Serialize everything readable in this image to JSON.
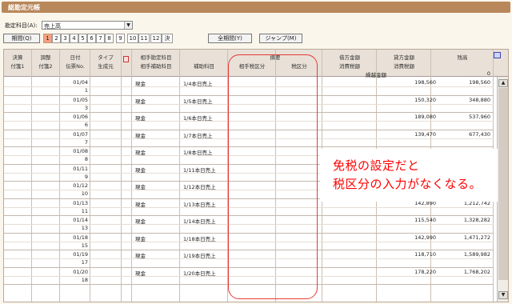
{
  "window": {
    "title": "総勘定元帳"
  },
  "account": {
    "label": "勘定科目(A):",
    "value": "売上高"
  },
  "period": {
    "label": "期間(Q)",
    "months": [
      "1",
      "2",
      "3",
      "4",
      "5",
      "6",
      "7",
      "8",
      "9",
      "10",
      "11",
      "12",
      "決"
    ],
    "selected": "1",
    "all_period_label": "全期間(Y)",
    "jump_label": "ジャンプ(M)"
  },
  "columns": {
    "kessan": "決算",
    "fusen1": "付箋1",
    "chosei": "調整",
    "fusen2": "付箋2",
    "hizuke": "日付",
    "denpyo": "伝票No.",
    "type": "タイプ",
    "seiseimoto": "生成元",
    "aite_kamoku": "相手勘定科目",
    "aite_hojo": "相手補助科目",
    "hojo": "補助科目",
    "tekiyo": "摘要",
    "aite_zeiku": "相手税区分",
    "zeiku": "税区分",
    "karikata": "借方金額",
    "shohizei1": "消費税額",
    "kashikata": "貸方金額",
    "shohizei2": "消費税額",
    "zandaka": "残高",
    "kurikoshi": "繰越金額",
    "kurikoshi_value": "0"
  },
  "rows": [
    {
      "date": "01/04",
      "no": "1",
      "account": "現金",
      "memo": "1/4本日売上",
      "credit": "198,560",
      "balance": "198,560"
    },
    {
      "date": "01/05",
      "no": "3",
      "account": "現金",
      "memo": "1/5本日売上",
      "credit": "150,320",
      "balance": "348,880"
    },
    {
      "date": "01/06",
      "no": "6",
      "account": "現金",
      "memo": "1/6本日売上",
      "credit": "189,080",
      "balance": "537,960"
    },
    {
      "date": "01/07",
      "no": "7",
      "account": "現金",
      "memo": "1/7本日売上",
      "credit": "139,470",
      "balance": "677,430"
    },
    {
      "date": "01/08",
      "no": "8",
      "account": "現金",
      "memo": "1/8本日売上",
      "credit": "",
      "balance": ""
    },
    {
      "date": "01/11",
      "no": "9",
      "account": "現金",
      "memo": "1/11本日売上",
      "credit": "",
      "balance": ""
    },
    {
      "date": "01/12",
      "no": "10",
      "account": "現金",
      "memo": "1/12本日売上",
      "credit": "",
      "balance": ""
    },
    {
      "date": "01/13",
      "no": "11",
      "account": "現金",
      "memo": "1/13本日売上",
      "credit": "142,890",
      "balance": "1,212,742"
    },
    {
      "date": "01/14",
      "no": "13",
      "account": "現金",
      "memo": "1/14本日売上",
      "credit": "115,540",
      "balance": "1,328,282"
    },
    {
      "date": "01/18",
      "no": "15",
      "account": "現金",
      "memo": "1/18本日売上",
      "credit": "142,990",
      "balance": "1,471,272"
    },
    {
      "date": "01/19",
      "no": "17",
      "account": "現金",
      "memo": "1/19本日売上",
      "credit": "118,710",
      "balance": "1,589,982"
    },
    {
      "date": "01/20",
      "no": "18",
      "account": "現金",
      "memo": "1/20本日売上",
      "credit": "178,220",
      "balance": "1,768,202"
    }
  ],
  "annotation": {
    "line1": "免税の設定だと",
    "line2": "税区分の入力がなくなる。",
    "color": "#ff0000"
  },
  "icons": {
    "scroll_up": "▲",
    "scroll_down": "▼",
    "dropdown": "▼"
  }
}
